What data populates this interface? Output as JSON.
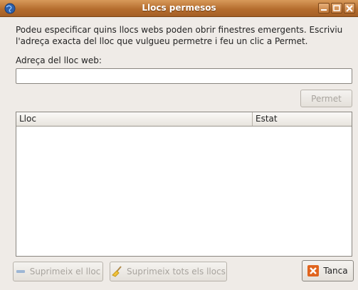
{
  "window": {
    "title": "Llocs permesos"
  },
  "description": "Podeu especificar quins llocs webs poden obrir finestres emergents. Escriviu l'adreça exacta del lloc que vulgueu permetre i feu un clic a Permet.",
  "url_field": {
    "label": "Adreça del lloc web:",
    "value": ""
  },
  "buttons": {
    "permet": "Permet",
    "remove": "Suprimeix el lloc",
    "remove_all": "Suprimeix tots els llocs",
    "close": "Tanca"
  },
  "table": {
    "columns": [
      "Lloc",
      "Estat"
    ],
    "rows": []
  },
  "icons": {
    "app": "globe-icon",
    "remove": "minus-icon",
    "remove_all": "broom-icon",
    "close": "close-x-icon"
  },
  "colors": {
    "titlebar": "#b56d2e",
    "close_icon": "#e0641e"
  }
}
